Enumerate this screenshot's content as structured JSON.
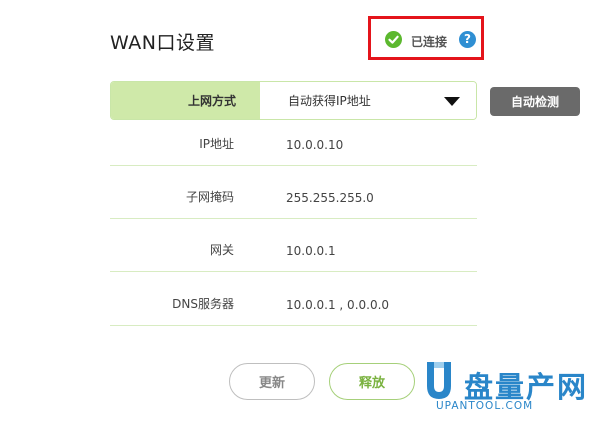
{
  "header": {
    "title": "WAN口设置",
    "status": {
      "text": "已连接",
      "help_glyph": "?",
      "check_color": "#5cb82e",
      "help_color": "#2f8fd3",
      "highlight_color": "#e4141b"
    }
  },
  "connection": {
    "label": "上网方式",
    "selected": "自动获得IP地址",
    "detect_label": "自动检测"
  },
  "info_rows": [
    {
      "label": "IP地址",
      "value": "10.0.0.10"
    },
    {
      "label": "子网掩码",
      "value": "255.255.255.0"
    },
    {
      "label": "网关",
      "value": "10.0.0.1"
    },
    {
      "label": "DNS服务器",
      "value": "10.0.0.1 , 0.0.0.0"
    }
  ],
  "actions": {
    "refresh_label": "更新",
    "release_label": "释放"
  },
  "watermark": {
    "cn": "盘量产网",
    "en": "UPANTOOL.COM"
  },
  "colors": {
    "accent_green": "#cfe9a9",
    "release_green": "#7ab240",
    "detect_gray": "#6a6a6a",
    "brand_blue": "#2a86c9"
  },
  "icons": [
    "check-circle-icon",
    "help-icon",
    "caret-down-icon",
    "u-logo-icon"
  ]
}
